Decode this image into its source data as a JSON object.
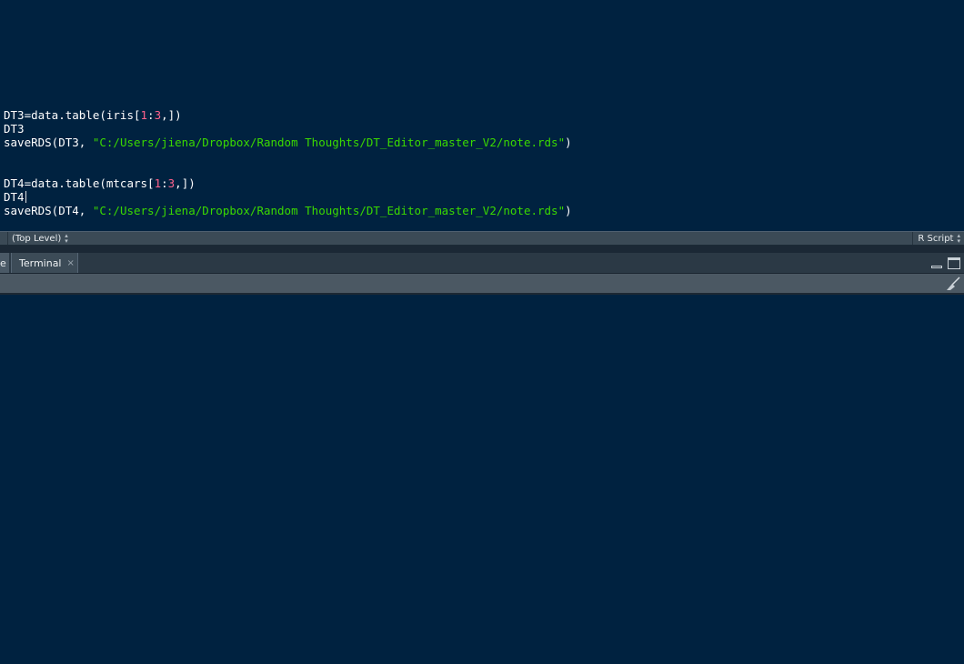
{
  "editor": {
    "lines": [
      [],
      [],
      [],
      [],
      [
        {
          "t": "DT3=data.table(iris["
        },
        {
          "t": "1",
          "c": "num"
        },
        {
          "t": ":"
        },
        {
          "t": "3",
          "c": "num"
        },
        {
          "t": ",])"
        }
      ],
      [
        {
          "t": "DT3"
        }
      ],
      [
        {
          "t": "saveRDS(DT3, "
        },
        {
          "t": "\"C:/Users/jiena/Dropbox/Random Thoughts/DT_Editor_master_V2/note.rds\"",
          "c": "str"
        },
        {
          "t": ")"
        }
      ],
      [],
      [],
      [
        {
          "t": "DT4=data.table(mtcars["
        },
        {
          "t": "1",
          "c": "num"
        },
        {
          "t": ":"
        },
        {
          "t": "3",
          "c": "num"
        },
        {
          "t": ",])"
        }
      ],
      [
        {
          "t": "DT4"
        },
        {
          "cursor": true
        }
      ],
      [
        {
          "t": "saveRDS(DT4, "
        },
        {
          "t": "\"C:/Users/jiena/Dropbox/Random Thoughts/DT_Editor_master_V2/note.rds\"",
          "c": "str"
        },
        {
          "t": ")"
        }
      ]
    ]
  },
  "status": {
    "scope": "(Top Level)",
    "filetype": "R Script"
  },
  "console_tabs": {
    "partial_tab_label": "e",
    "terminal_label": "Terminal",
    "close_glyph": "×"
  },
  "icons": {
    "updown": "⬍",
    "broom": "broom-icon"
  },
  "colors": {
    "background": "#002240",
    "number": "#ff628c",
    "string": "#3ad900",
    "text": "#ffffff"
  }
}
